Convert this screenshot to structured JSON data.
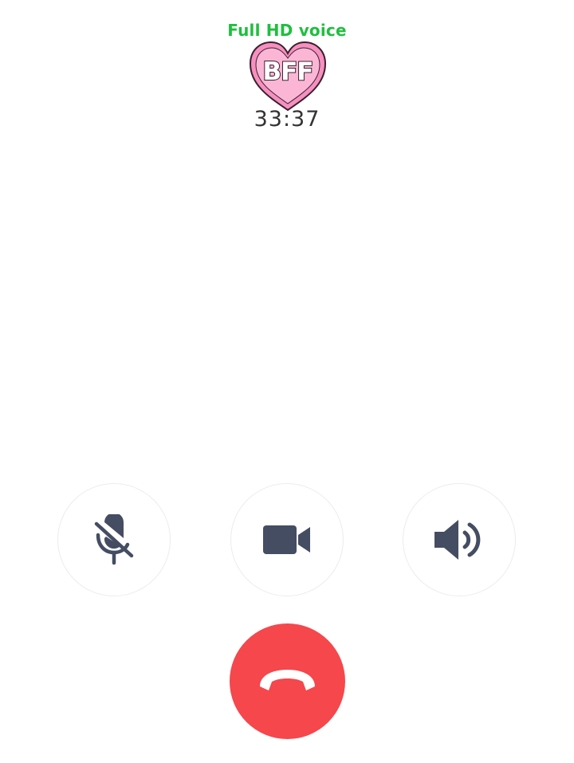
{
  "call": {
    "quality_label": "Full HD voice",
    "avatar_text": "BFF",
    "duration": "33:37"
  },
  "controls": [
    {
      "name": "mute-button",
      "icon": "microphone-muted-icon"
    },
    {
      "name": "video-button",
      "icon": "video-camera-icon"
    },
    {
      "name": "speaker-button",
      "icon": "speaker-icon"
    }
  ],
  "end_call": {
    "icon": "hang-up-phone-icon"
  },
  "colors": {
    "quality_label": "#1fbf3f",
    "icon": "#454d63",
    "end_call": "#f5474c",
    "avatar_heart": "#f78fbf"
  }
}
